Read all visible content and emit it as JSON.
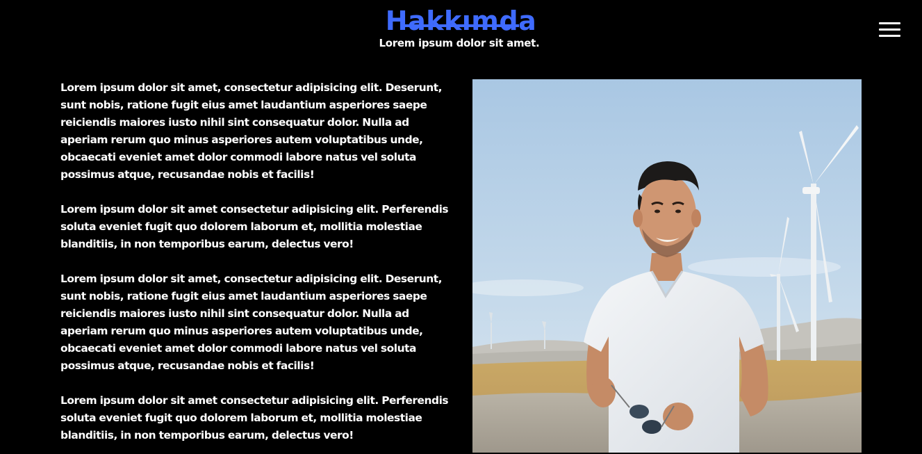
{
  "header": {
    "title": "Hakkımda",
    "subtitle": "Lorem ipsum dolor sit amet.",
    "accent_color": "#3f6bff",
    "menu_icon": "hamburger-menu-icon"
  },
  "about": {
    "paragraphs": [
      "Lorem ipsum dolor sit amet, consectetur adipisicing elit. Deserunt, sunt nobis, ratione fugit eius amet laudantium asperiores saepe reiciendis maiores iusto nihil sint consequatur dolor. Nulla ad aperiam rerum quo minus asperiores autem voluptatibus unde, obcaecati eveniet amet dolor commodi labore natus vel soluta possimus atque, recusandae nobis et facilis!",
      "Lorem ipsum dolor sit amet consectetur adipisicing elit. Perferendis soluta eveniet fugit quo dolorem laborum et, mollitia molestiae blanditiis, in non temporibus earum, delectus vero!",
      "Lorem ipsum dolor sit amet, consectetur adipisicing elit. Deserunt, sunt nobis, ratione fugit eius amet laudantium asperiores saepe reiciendis maiores iusto nihil sint consequatur dolor. Nulla ad aperiam rerum quo minus asperiores autem voluptatibus unde, obcaecati eveniet amet dolor commodi labore natus vel soluta possimus atque, recusandae nobis et facilis!",
      "Lorem ipsum dolor sit amet consectetur adipisicing elit. Perferendis soluta eveniet fugit quo dolorem laborum et, mollitia molestiae blanditiis, in non temporibus earum, delectus vero!"
    ]
  },
  "colors": {
    "background": "#000000",
    "text": "#ffffff",
    "accent": "#3f6bff"
  }
}
